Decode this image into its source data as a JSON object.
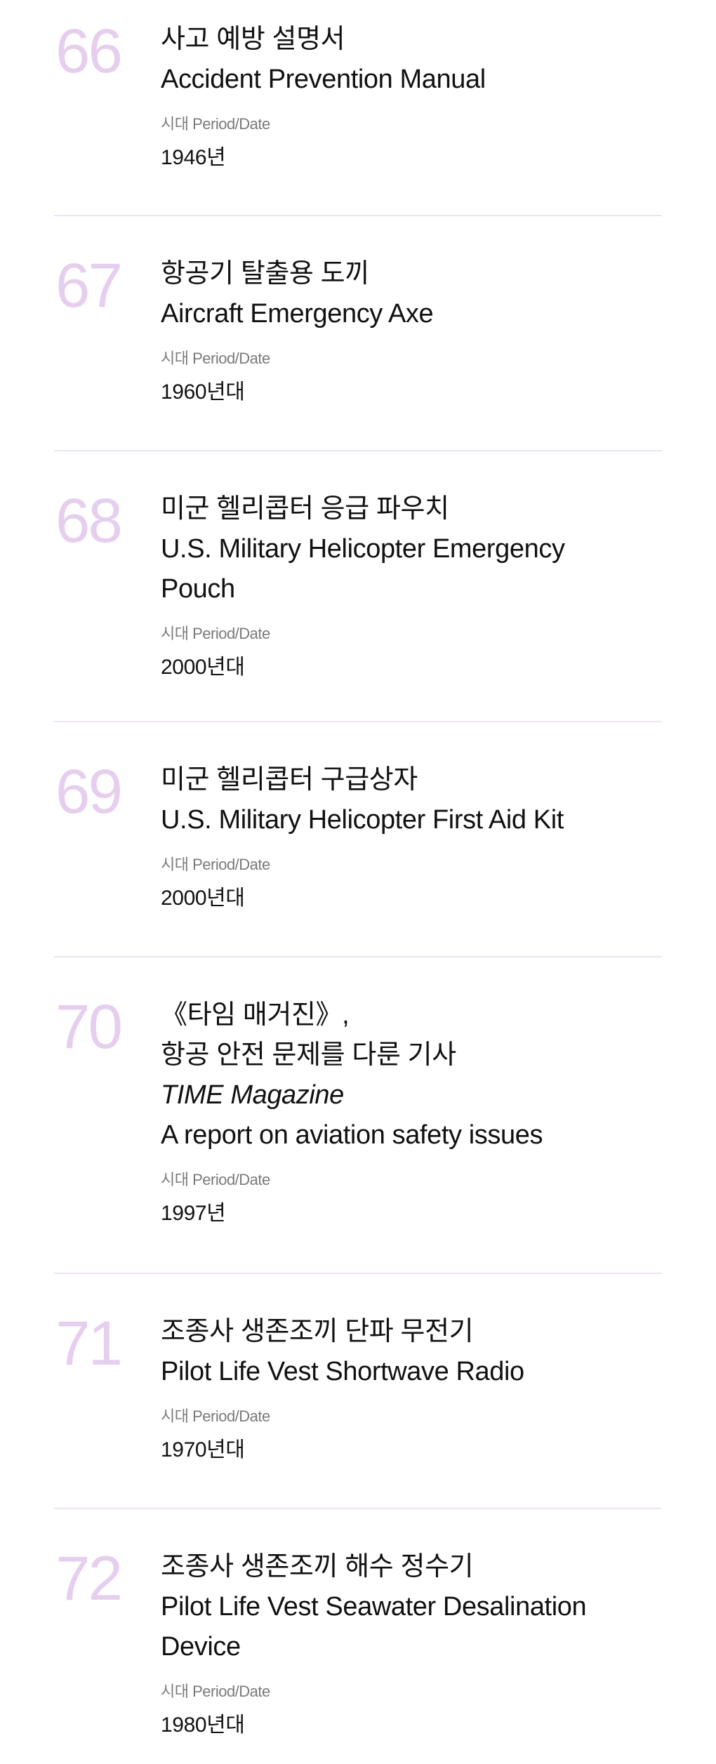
{
  "meta_label": "시대 Period/Date",
  "items": [
    {
      "num": "66",
      "lines": [
        "사고 예방 설명서",
        "Accident Prevention Manual"
      ],
      "date": "1946년"
    },
    {
      "num": "67",
      "lines": [
        "항공기 탈출용 도끼",
        "Aircraft Emergency Axe"
      ],
      "date": "1960년대"
    },
    {
      "num": "68",
      "lines": [
        "미군 헬리콥터 응급 파우치",
        "U.S. Military Helicopter Emergency",
        "Pouch"
      ],
      "date": "2000년대"
    },
    {
      "num": "69",
      "lines": [
        "미군 헬리콥터 구급상자",
        "U.S. Military Helicopter First Aid Kit"
      ],
      "date": "2000년대"
    },
    {
      "num": "70",
      "lines": [
        "《타임 매거진》,",
        "항공 안전 문제를 다룬 기사",
        "TIME Magazine",
        "A report on aviation safety issues"
      ],
      "date": "1997년"
    },
    {
      "num": "71",
      "lines": [
        "조종사 생존조끼 단파 무전기",
        "Pilot Life Vest Shortwave Radio"
      ],
      "date": "1970년대"
    },
    {
      "num": "72",
      "lines": [
        "조종사 생존조끼 해수 정수기",
        "Pilot Life Vest Seawater Desalination",
        "Device"
      ],
      "date": "1980년대"
    }
  ],
  "colors": {
    "number": "#e6cfee",
    "divider": "#ede3f1",
    "label": "#7a7a7a",
    "text": "#111111"
  }
}
